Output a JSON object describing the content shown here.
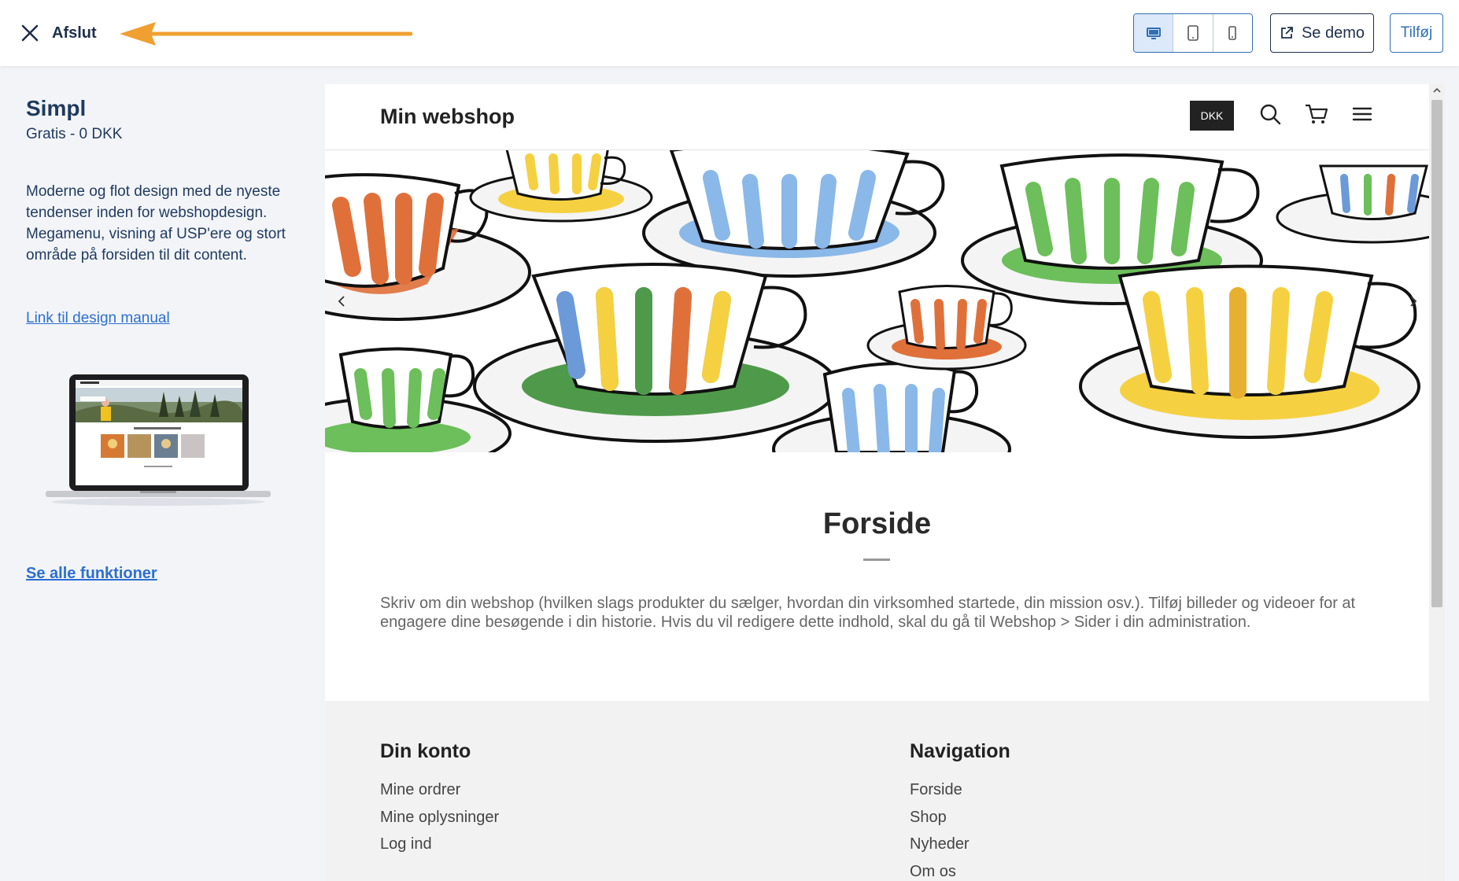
{
  "topbar": {
    "exit_label": "Afslut",
    "exit_icon": "close-icon",
    "device_buttons": [
      {
        "icon": "desktop-icon",
        "active": true
      },
      {
        "icon": "tablet-icon",
        "active": false
      },
      {
        "icon": "mobile-icon",
        "active": false
      }
    ],
    "demo_label": "Se demo",
    "demo_icon": "external-link-icon",
    "add_label": "Tilføj",
    "arrow_color": "#f0a030"
  },
  "sidebar": {
    "theme_name": "Simpl",
    "price": "Gratis - 0 DKK",
    "description": "Moderne og flot design med de nyeste tendenser inden for webshopdesign. Megamenu, visning af USP'ere og stort område på forsiden til dit content.",
    "manual_link": "Link til design manual",
    "all_features_link": "Se alle funktioner"
  },
  "preview": {
    "shop_title": "Min webshop",
    "currency": "DKK",
    "header_icons": [
      "search-icon",
      "cart-icon",
      "menu-icon"
    ],
    "page_heading": "Forside",
    "page_text": "Skriv om din webshop (hvilken slags produkter du sælger, hvordan din virksomhed startede, din mission osv.). Tilføj billeder og videoer for at engagere dine besøgende i din historie. Hvis du vil redigere dette indhold, skal du gå til Webshop > Sider i din administration.",
    "footer": {
      "account_heading": "Din konto",
      "account_links": [
        "Mine ordrer",
        "Mine oplysninger",
        "Log ind"
      ],
      "nav_heading": "Navigation",
      "nav_links": [
        "Forside",
        "Shop",
        "Nyheder",
        "Om os"
      ]
    }
  },
  "colors": {
    "brand_blue": "#2f6fb3",
    "link_blue": "#2c6fcf",
    "sidebar_text": "#1f3a5f",
    "cup_orange": "#e0703a",
    "cup_yellow": "#f5d142",
    "cup_blue": "#8ab8e8",
    "cup_green": "#6cbf5a"
  }
}
